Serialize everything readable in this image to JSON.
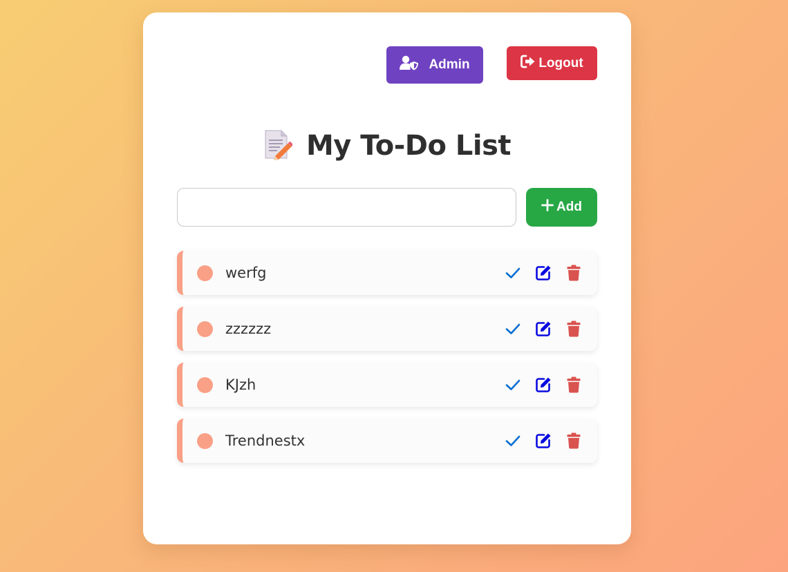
{
  "header": {
    "admin_label": "Admin",
    "logout_label": "Logout",
    "admin_color": "#6f42c1",
    "logout_color": "#dc3545"
  },
  "title": {
    "emoji": "📝",
    "text": "My To-Do List"
  },
  "add_form": {
    "input_value": "",
    "input_placeholder": "",
    "add_label": "Add",
    "add_color": "#28a745"
  },
  "tasks": [
    {
      "text": "werfg",
      "completed": false
    },
    {
      "text": "zzzzzz",
      "completed": false
    },
    {
      "text": "KJzh",
      "completed": false
    },
    {
      "text": "Trendnestx",
      "completed": false
    }
  ],
  "icons": {
    "admin": "user-shield-icon",
    "logout": "sign-out-icon",
    "add": "plus-icon",
    "complete": "check-icon",
    "edit": "edit-icon",
    "delete": "trash-icon",
    "title": "memo-icon"
  },
  "colors": {
    "accent": "#f9a086",
    "check": "#0a6ed1",
    "edit": "#0a0ae0",
    "delete": "#d9534f"
  }
}
